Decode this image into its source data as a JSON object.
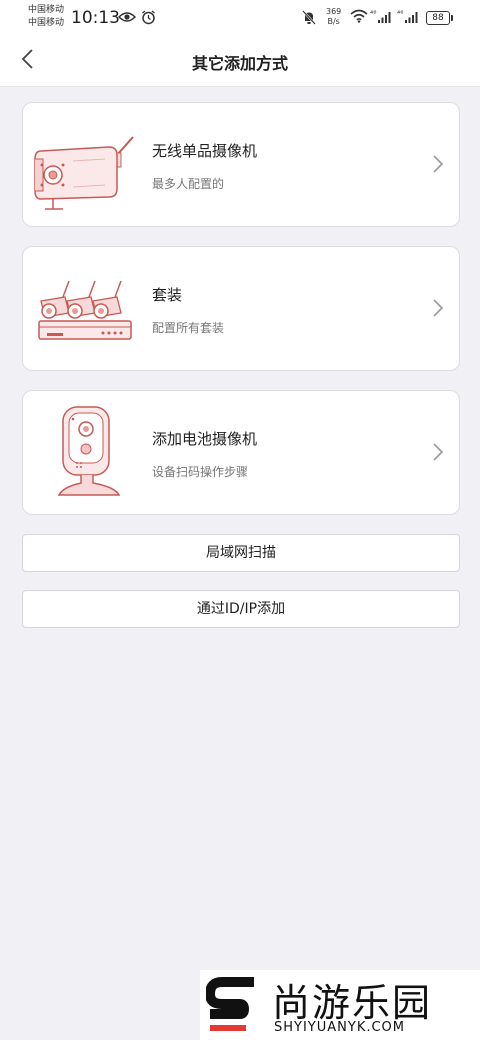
{
  "status_bar": {
    "carrier_1": "中国移动",
    "carrier_2": "中国移动",
    "time": "10:13",
    "net_speed_value": "369",
    "net_speed_unit": "B/s",
    "signal_1": "⁴⁶",
    "signal_2": "⁴⁶",
    "battery": "88"
  },
  "header": {
    "title": "其它添加方式"
  },
  "options": [
    {
      "title": "无线单品摄像机",
      "subtitle": "最多人配置的"
    },
    {
      "title": "套装",
      "subtitle": "配置所有套装"
    },
    {
      "title": "添加电池摄像机",
      "subtitle": "设备扫码操作步骤"
    }
  ],
  "buttons": {
    "lan_scan": "局域网扫描",
    "add_by_id": "通过ID/IP添加"
  },
  "watermark": {
    "name": "尚游乐园",
    "url": "SHYIYUANYK.COM"
  },
  "colors": {
    "accent": "#d9534f",
    "background": "#f1f1f5"
  }
}
